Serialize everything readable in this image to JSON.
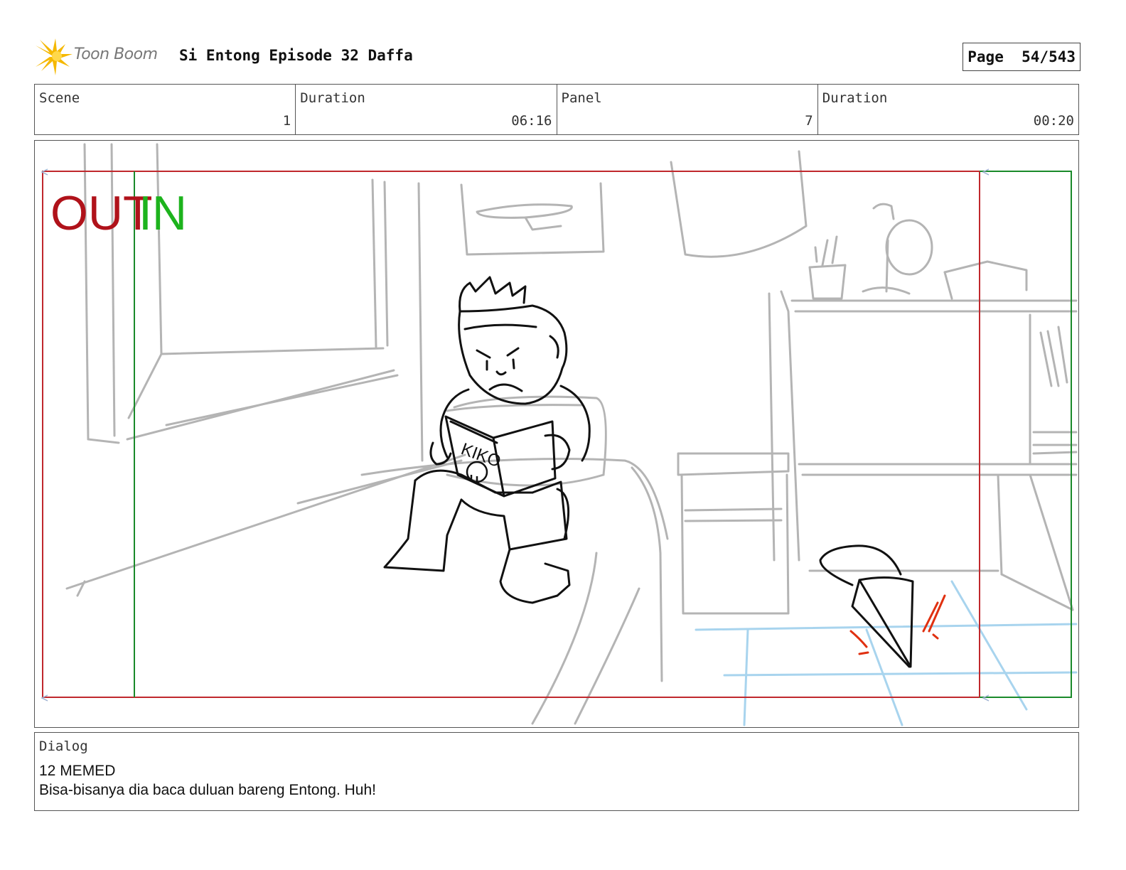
{
  "header": {
    "logo_text": "Toon Boom",
    "title": "Si Entong Episode 32 Daffa",
    "page_label": "Page",
    "page_value": "54/543"
  },
  "info": {
    "scene_label": "Scene",
    "scene_value": "1",
    "scene_duration_label": "Duration",
    "scene_duration_value": "06:16",
    "panel_label": "Panel",
    "panel_value": "7",
    "panel_duration_label": "Duration",
    "panel_duration_value": "00:20"
  },
  "panel": {
    "out_label": "OUT",
    "in_label": "IN",
    "book_text": "KIKO",
    "colors": {
      "out_frame": "#c0282d",
      "in_frame": "#1a8a2a",
      "in_text": "#1db31d",
      "sketch_grey": "#b0b0b0",
      "floor_blue": "#a8d4ee",
      "accent_red": "#e03010"
    }
  },
  "dialog": {
    "label": "Dialog",
    "line1": "12 MEMED",
    "line2": "Bisa-bisanya dia baca duluan bareng Entong. Huh!"
  }
}
